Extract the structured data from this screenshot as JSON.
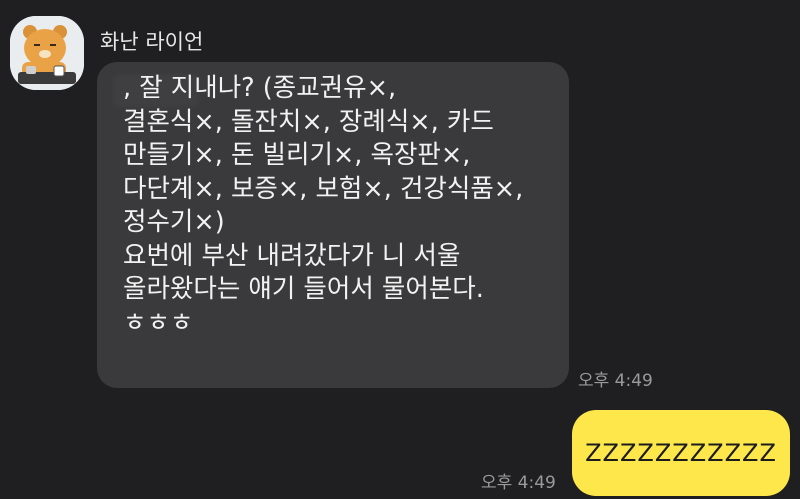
{
  "colors": {
    "background": "#1f1f21",
    "incoming_bubble": "#3a3a3c",
    "outgoing_bubble": "#fde74a",
    "time_text": "#9a9a9c"
  },
  "chat": {
    "sender": {
      "name": "화난 라이언",
      "avatar_icon": "ryan-character-icon"
    },
    "incoming": {
      "text": "       , 잘 지내나? (종교권유×,\n결혼식×, 돌잔치×, 장례식×, 카드\n만들기×, 돈 빌리기×, 옥장판×,\n다단계×, 보증×, 보험×, 건강식품×,\n정수기×)\n요번에 부산 내려갔다가 니 서울\n올라왔다는 얘기 들어서 물어본다.\nㅎㅎㅎ",
      "time": "오후 4:49"
    },
    "outgoing": {
      "text": "ZZZZZZZZZZZ",
      "time": "오후 4:49"
    }
  }
}
